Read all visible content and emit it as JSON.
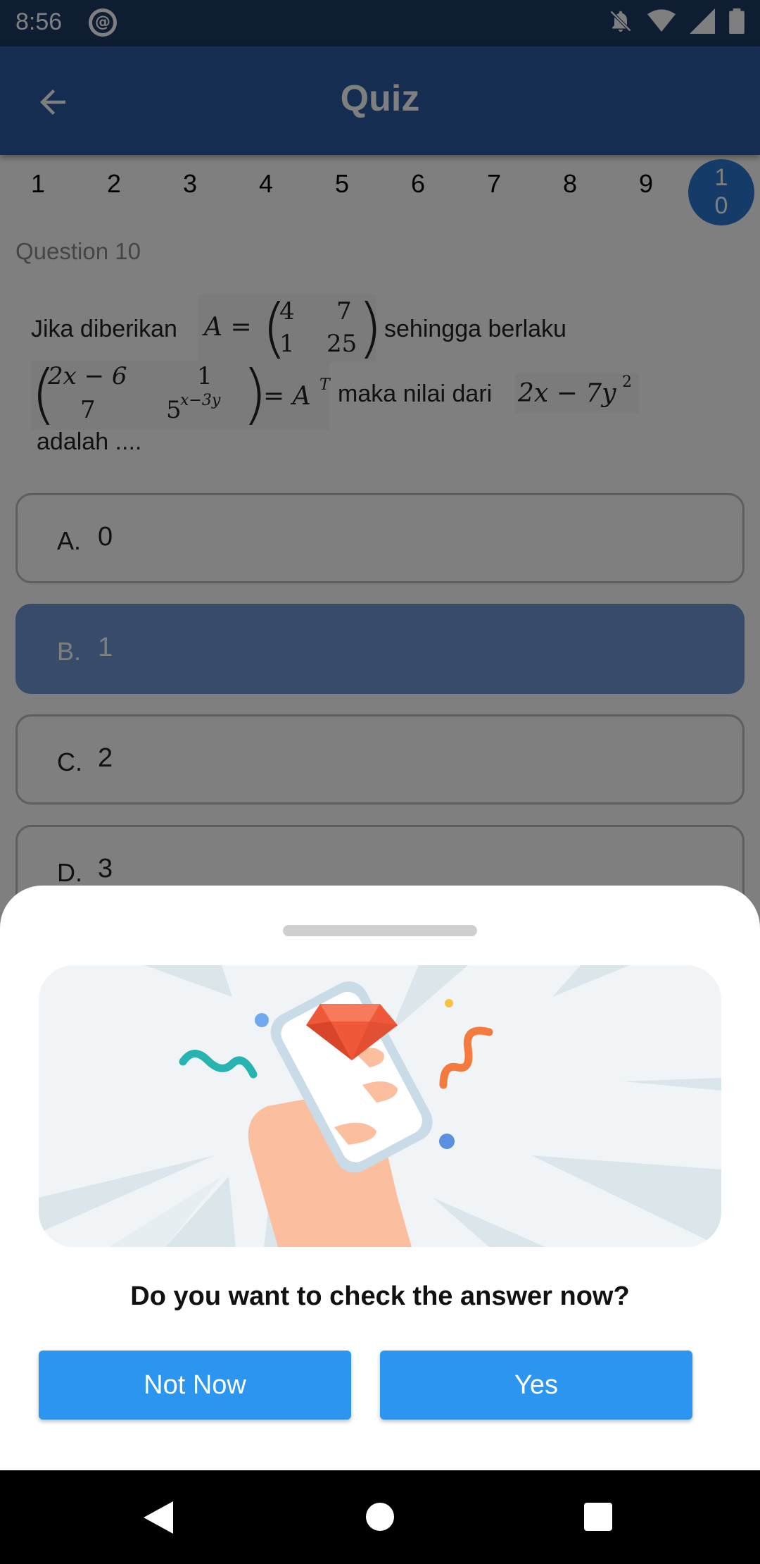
{
  "status_bar": {
    "time": "8:56"
  },
  "app_bar": {
    "title": "Quiz"
  },
  "question_nav": {
    "numbers": [
      "1",
      "2",
      "3",
      "4",
      "5",
      "6",
      "7",
      "8",
      "9"
    ],
    "active_top": "1",
    "active_bottom": "0"
  },
  "question": {
    "label": "Question 10",
    "text_part1": "Jika diberikan",
    "text_part2": "sehingga berlaku",
    "text_part3": "maka nilai dari",
    "text_part4": "adalah ....",
    "matrix_a": {
      "lhs": "A =",
      "r1c1": "4",
      "r1c2": "7",
      "r2c1": "1",
      "r2c2": "25"
    },
    "matrix_b": {
      "r1c1": "2x − 6",
      "r1c2": "1",
      "r2c1": "7",
      "r2c2": "5",
      "r2c2_exp": "x−3y",
      "rhs": "= A",
      "rhs_sup": "T"
    },
    "expression": {
      "base": "2x − 7y",
      "sup": "2"
    }
  },
  "options": [
    {
      "letter": "A.",
      "value": "0",
      "selected": false
    },
    {
      "letter": "B.",
      "value": "1",
      "selected": true
    },
    {
      "letter": "C.",
      "value": "2",
      "selected": false
    },
    {
      "letter": "D.",
      "value": "3",
      "selected": false
    }
  ],
  "sheet": {
    "question": "Do you want to check the answer now?",
    "not_now_label": "Not Now",
    "yes_label": "Yes"
  },
  "colors": {
    "app_bar": "#2a5aa0",
    "status_bar": "#1e3a66",
    "active_question": "#2a76d2",
    "selected_option": "#6f98d6",
    "button": "#2b95f0"
  }
}
